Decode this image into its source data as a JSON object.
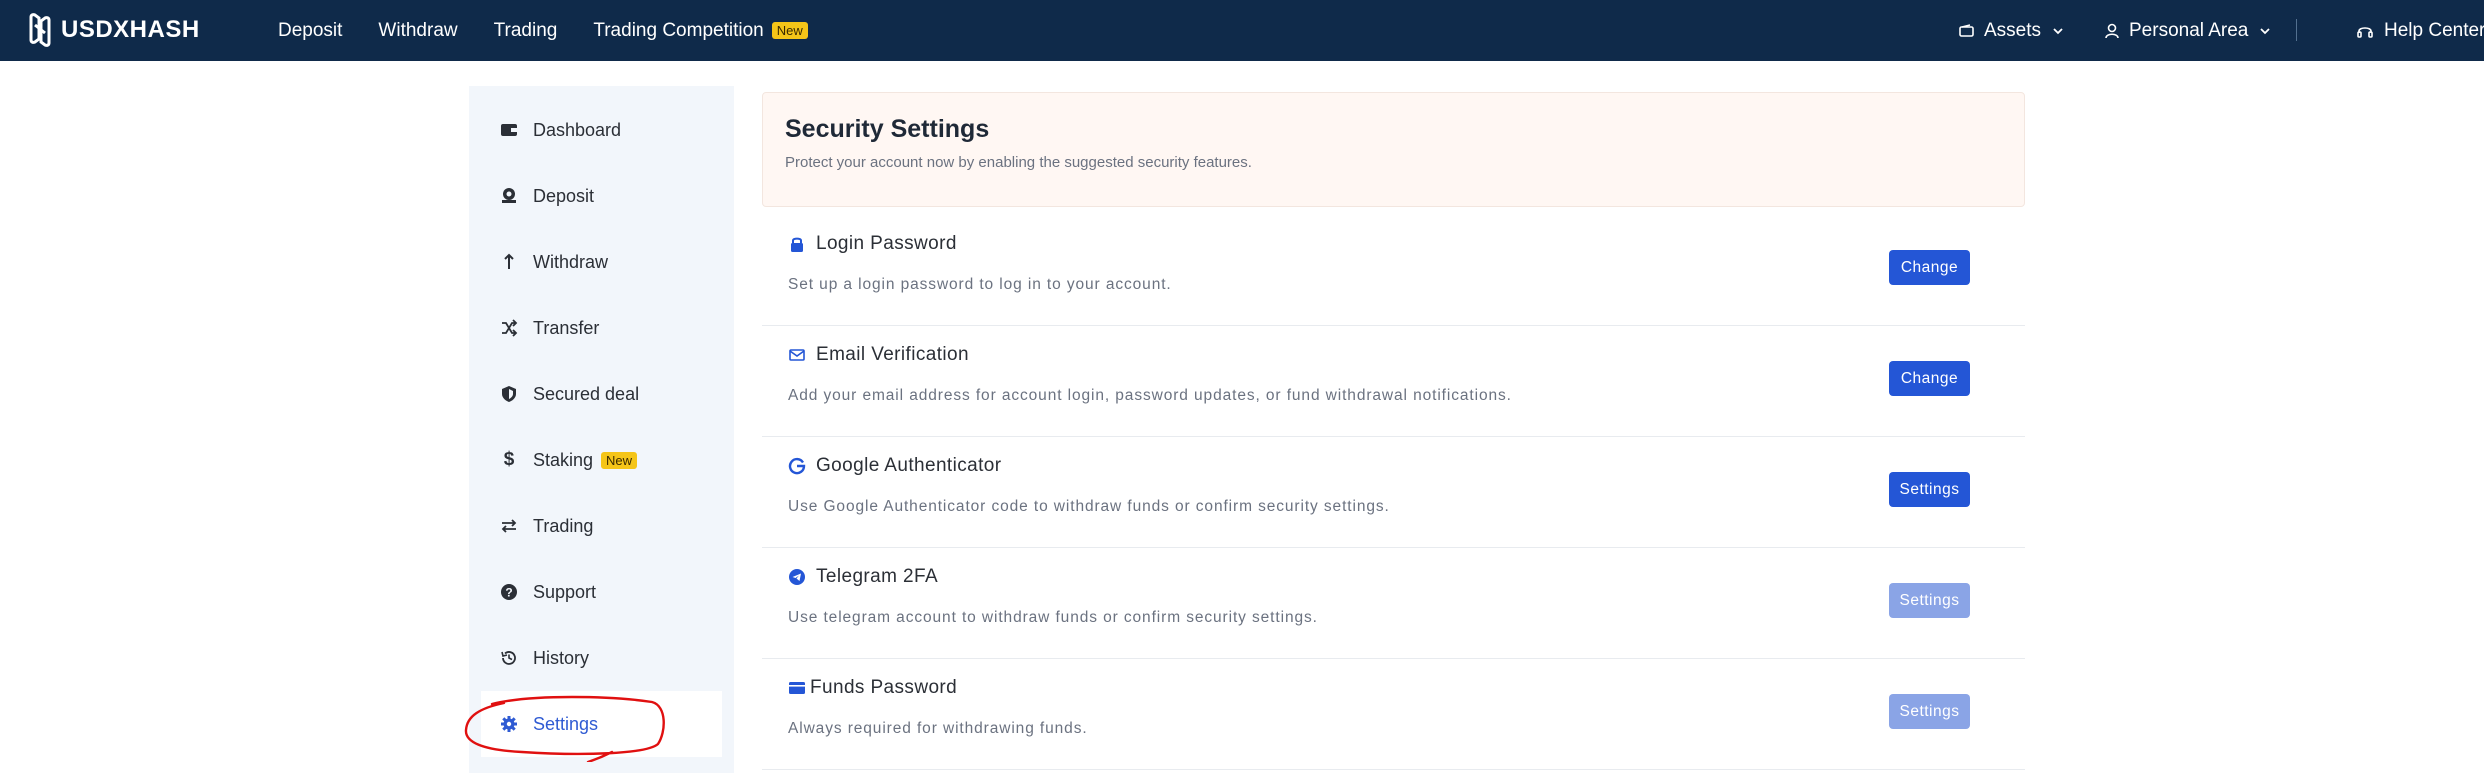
{
  "brand": {
    "name": "USDXHASH"
  },
  "nav": {
    "items": [
      {
        "label": "Deposit"
      },
      {
        "label": "Withdraw"
      },
      {
        "label": "Trading"
      },
      {
        "label": "Trading Competition",
        "badge": "New"
      }
    ],
    "assets": "Assets",
    "personal": "Personal Area",
    "help": "Help Center"
  },
  "sidebar": {
    "items": [
      {
        "label": "Dashboard",
        "icon": "wallet-icon"
      },
      {
        "label": "Deposit",
        "icon": "deposit-icon"
      },
      {
        "label": "Withdraw",
        "icon": "arrow-up-icon"
      },
      {
        "label": "Transfer",
        "icon": "shuffle-icon"
      },
      {
        "label": "Secured deal",
        "icon": "shield-icon"
      },
      {
        "label": "Staking",
        "icon": "dollar-icon",
        "badge": "New"
      },
      {
        "label": "Trading",
        "icon": "exchange-icon"
      },
      {
        "label": "Support",
        "icon": "question-icon"
      },
      {
        "label": "History",
        "icon": "history-icon"
      },
      {
        "label": "Settings",
        "icon": "gear-icon",
        "active": true
      }
    ]
  },
  "security": {
    "title": "Security Settings",
    "subtitle": "Protect your account now by enabling the suggested security features.",
    "rows": [
      {
        "title": "Login Password",
        "icon": "lock-icon",
        "desc": "Set up a login password to log in to your account.",
        "button": "Change",
        "enabled": true
      },
      {
        "title": "Email Verification",
        "icon": "mail-icon",
        "desc": "Add your email address for account login, password updates, or fund withdrawal notifications.",
        "button": "Change",
        "enabled": true
      },
      {
        "title": "Google Authenticator",
        "icon": "google-icon",
        "desc": "Use Google Authenticator code to withdraw funds or confirm security settings.",
        "button": "Settings",
        "enabled": true
      },
      {
        "title": "Telegram 2FA",
        "icon": "telegram-icon",
        "desc": "Use telegram account to withdraw funds or confirm security settings.",
        "button": "Settings",
        "enabled": false
      },
      {
        "title": "Funds Password",
        "icon": "card-icon",
        "desc": "Always required for withdrawing funds.",
        "button": "Settings",
        "enabled": false
      }
    ]
  },
  "colors": {
    "navbar": "#0f2a4a",
    "accent": "#2456d6",
    "accent_disabled": "#8aa4e6",
    "annotation": "#e01010"
  }
}
